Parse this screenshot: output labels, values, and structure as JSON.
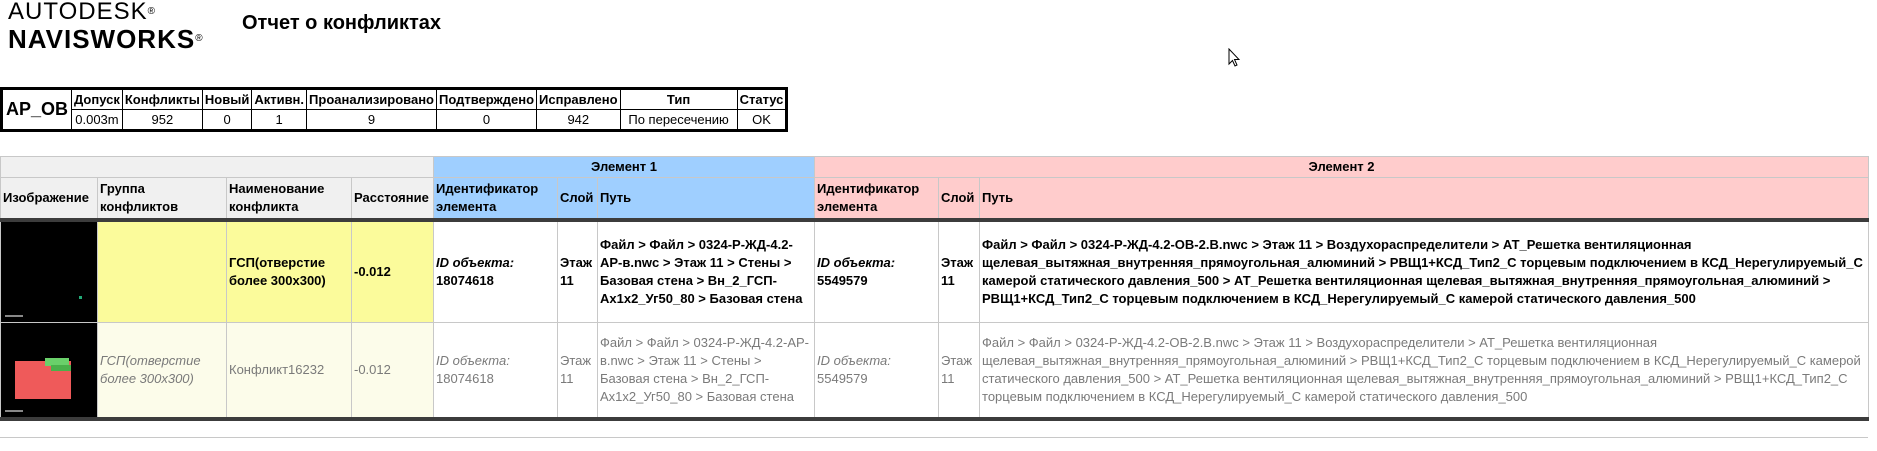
{
  "logo": {
    "brand": "AUTODESK",
    "product": "NAVISWORKS"
  },
  "report_title": "Отчет о конфликтах",
  "summary": {
    "test_name": "AP_OB",
    "headers": [
      "Допуск",
      "Конфликты",
      "Новый",
      "Активн.",
      "Проанализировано",
      "Подтверждено",
      "Исправлено",
      "Тип",
      "Статус"
    ],
    "values": [
      "0.003m",
      "952",
      "0",
      "1",
      "9",
      "0",
      "942",
      "По пересечению",
      "OK"
    ]
  },
  "results": {
    "group_element1": "Элемент 1",
    "group_element2": "Элемент 2",
    "columns": {
      "image": "Изображение",
      "group": "Группа конфликтов",
      "name": "Наименование конфликта",
      "distance": "Расстояние",
      "e1_id": "Идентификатор элемента",
      "e1_layer": "Слой",
      "e1_path": "Путь",
      "e2_id": "Идентификатор элемента",
      "e2_layer": "Слой",
      "e2_path": "Путь"
    },
    "rows": [
      {
        "group": "",
        "name": "ГСП(отверстие более 300х300)",
        "distance": "-0.012",
        "e1_id_label": "ID объекта",
        "e1_id_value": "18074618",
        "e1_layer": "Этаж 11",
        "e1_path": "Файл > Файл > 0324-Р-ЖД-4.2-АР-в.nwc > Этаж 11 > Стены > Базовая стена > Вн_2_ГСП-Ах1х2_Уг50_80 > Базовая стена",
        "e2_id_label": "ID объекта",
        "e2_id_value": "5549579",
        "e2_layer": "Этаж 11",
        "e2_path": "Файл > Файл > 0324-Р-ЖД-4.2-ОВ-2.В.nwc > Этаж 11 > Воздухораспределители > АТ_Решетка вентиляционная щелевая_вытяжная_внутренняя_прямоугольная_алюминий > РВЩ1+КСД_Тип2_С торцевым подключением в КСД_Нерегулируемый_С камерой статического давления_500 > АТ_Решетка вентиляционная щелевая_вытяжная_внутренняя_прямоугольная_алюминий > РВЩ1+КСД_Тип2_С торцевым подключением в КСД_Нерегулируемый_С камерой статического давления_500"
      },
      {
        "group": "ГСП(отверстие более 300х300)",
        "name": "Конфликт16232",
        "distance": "-0.012",
        "e1_id_label": "ID объекта",
        "e1_id_value": "18074618",
        "e1_layer": "Этаж 11",
        "e1_path": "Файл > Файл > 0324-Р-ЖД-4.2-АР-в.nwc > Этаж 11 > Стены > Базовая стена > Вн_2_ГСП-Ах1х2_Уг50_80 > Базовая стена",
        "e2_id_label": "ID объекта",
        "e2_id_value": "5549579",
        "e2_layer": "Этаж 11",
        "e2_path": "Файл > Файл > 0324-Р-ЖД-4.2-ОВ-2.В.nwc > Этаж 11 > Воздухораспределители > АТ_Решетка вентиляционная щелевая_вытяжная_внутренняя_прямоугольная_алюминий > РВЩ1+КСД_Тип2_С торцевым подключением в КСД_Нерегулируемый_С камерой статического давления_500 > АТ_Решетка вентиляционная щелевая_вытяжная_внутренняя_прямоугольная_алюминий > РВЩ1+КСД_Тип2_С торцевым подключением в КСД_Нерегулируемый_С камерой статического давления_500"
      }
    ]
  },
  "colors": {
    "element1": "#9fcfff",
    "element2": "#ffcccc",
    "highlight": "#fbfb9b"
  }
}
